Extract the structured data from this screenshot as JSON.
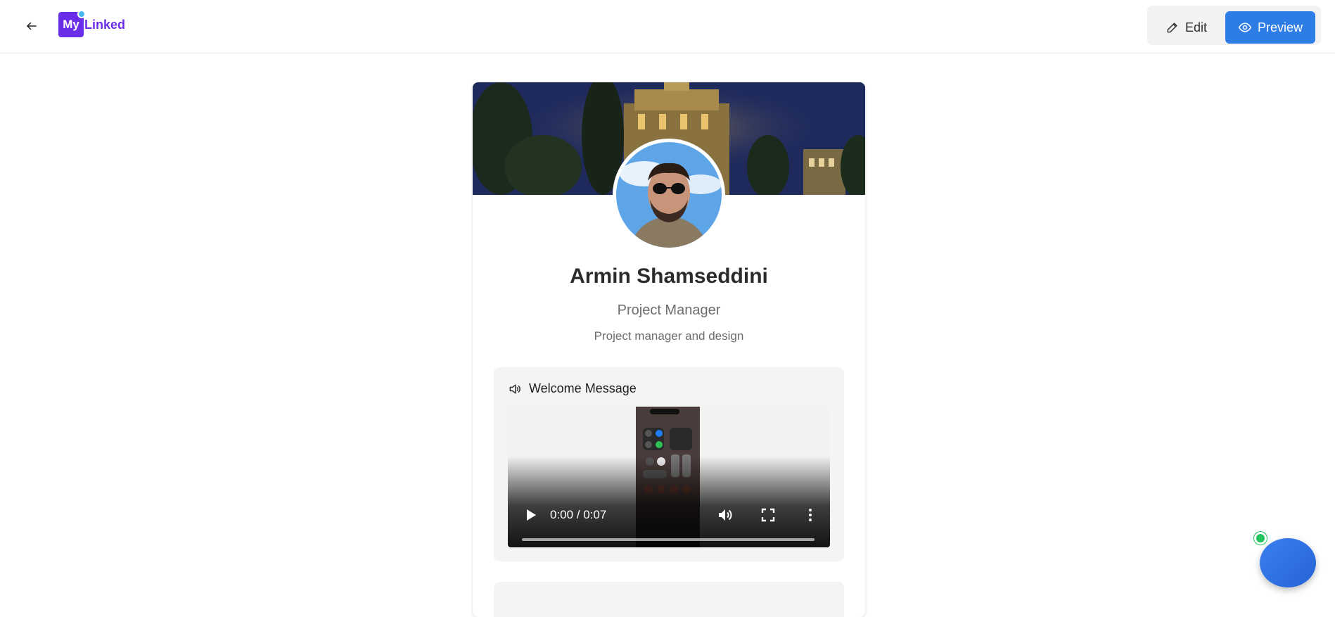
{
  "header": {
    "logo": {
      "prefix": "My",
      "suffix": "Linked"
    },
    "edit_label": "Edit",
    "preview_label": "Preview"
  },
  "profile": {
    "name": "Armin Shamseddini",
    "title": "Project Manager",
    "bio": "Project manager and design"
  },
  "welcome": {
    "title": "Welcome Message",
    "video": {
      "time": "0:00 / 0:07",
      "progress": 0
    }
  },
  "colors": {
    "brand": "#6b2ee8",
    "primary": "#2e7de6",
    "status": "#22c55e"
  }
}
